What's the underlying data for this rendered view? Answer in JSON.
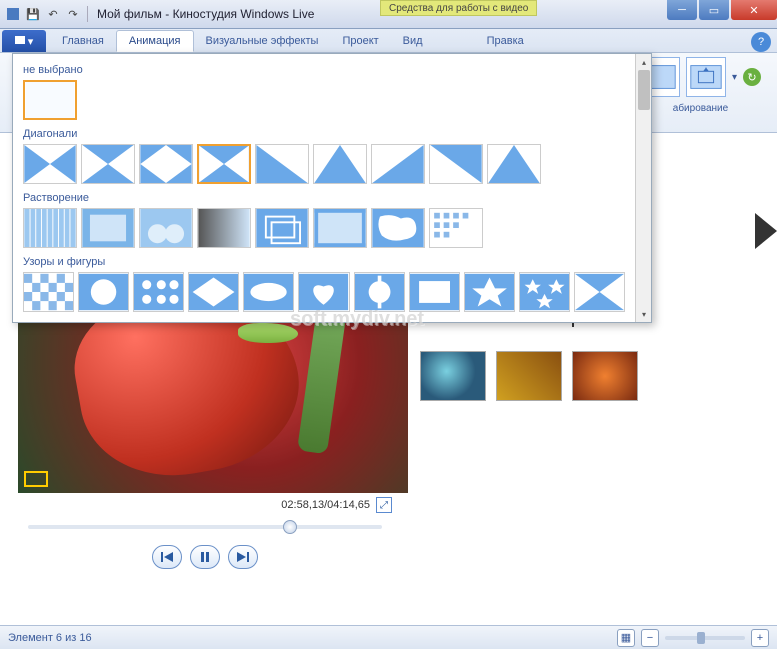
{
  "window": {
    "title": "Мой фильм - Киностудия Windows Live",
    "tool_tab": "Средства для работы с видео"
  },
  "ribbon": {
    "tabs": [
      "Главная",
      "Анимация",
      "Визуальные эффекты",
      "Проект",
      "Вид",
      "Правка"
    ],
    "active_tab_index": 1,
    "group_scale_label": "абирование"
  },
  "gallery": {
    "cat_none": "не выбрано",
    "cat_diagonals": "Диагонали",
    "cat_dissolve": "Растворение",
    "cat_patterns": "Узоры и фигуры"
  },
  "preview": {
    "time": "02:58,13/04:14,65"
  },
  "status": {
    "text": "Элемент 6 из 16"
  },
  "watermark": "soft.mydiv.net"
}
